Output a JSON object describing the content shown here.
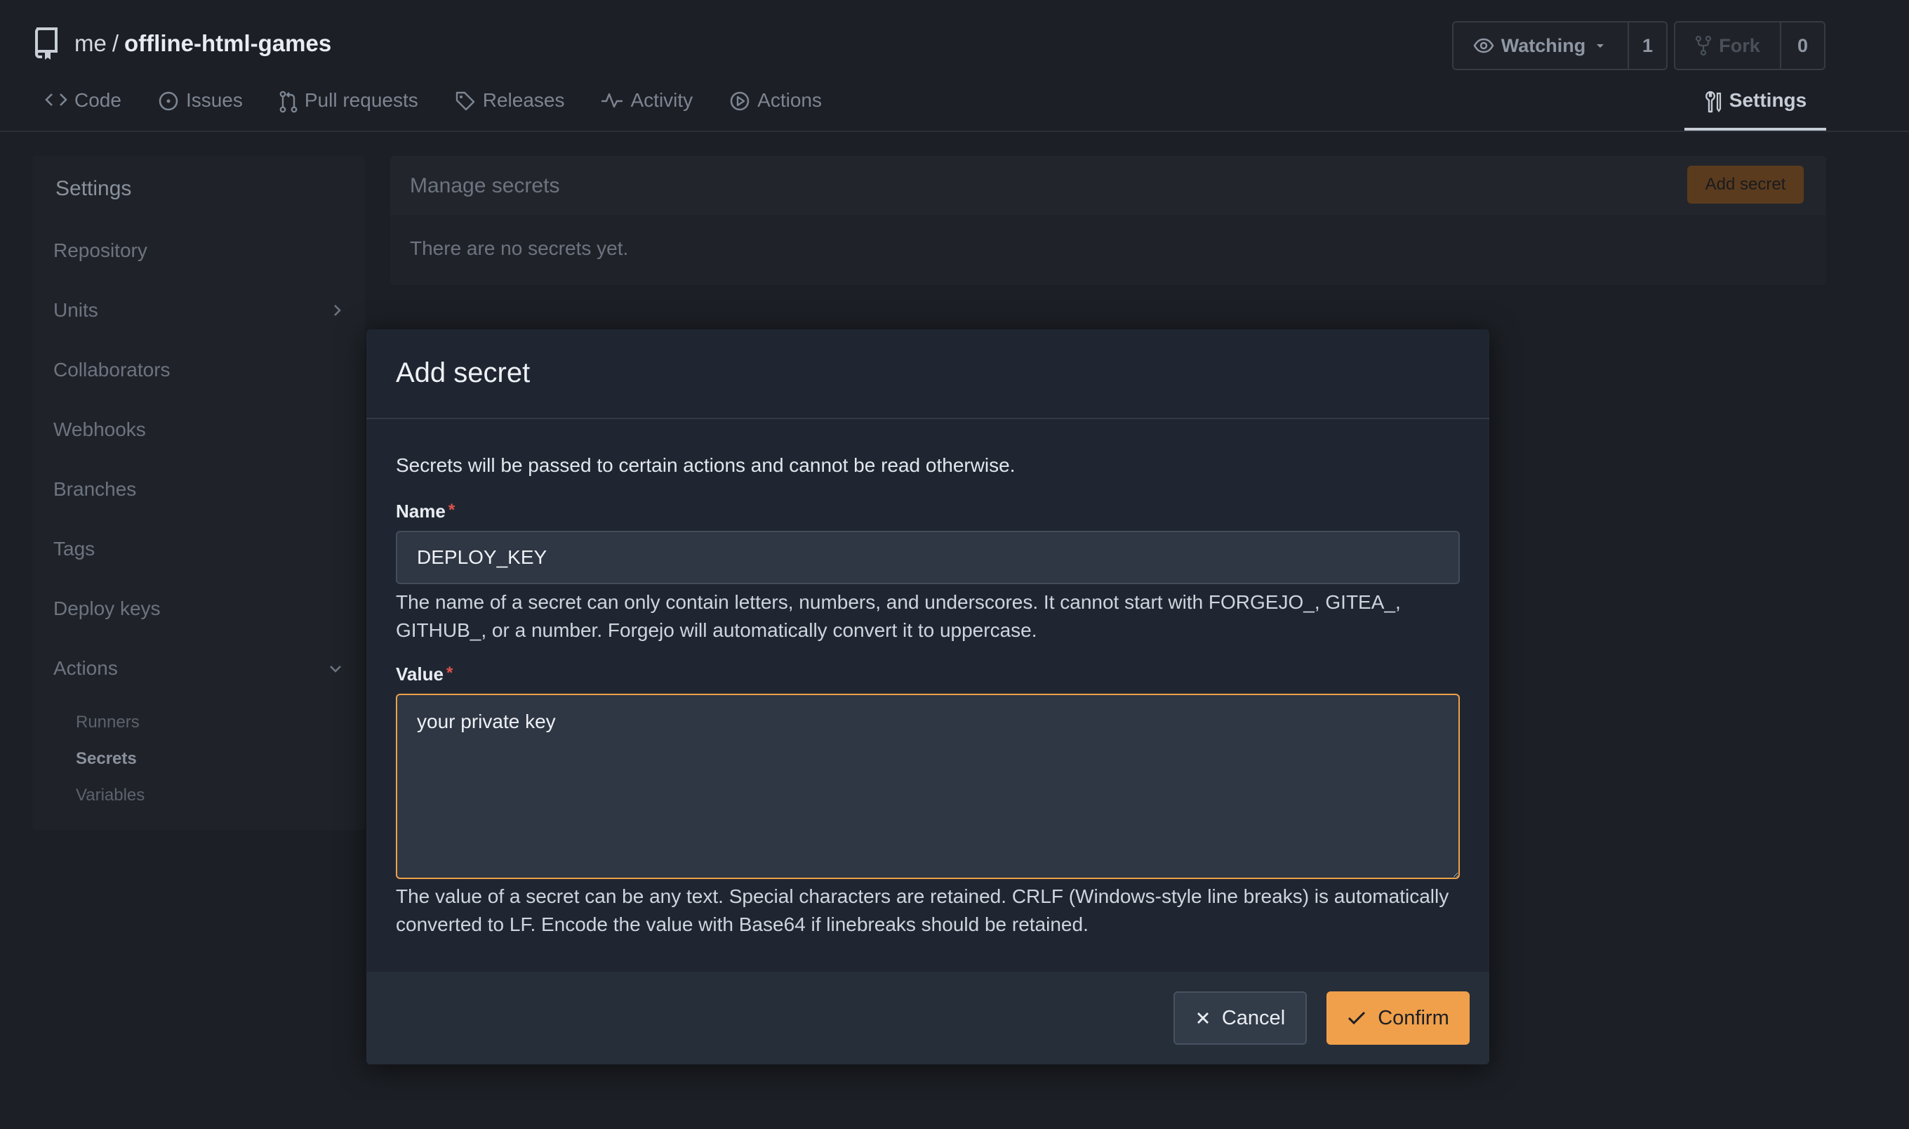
{
  "repo": {
    "owner": "me",
    "separator": "/",
    "name": "offline-html-games"
  },
  "header": {
    "watch": {
      "label": "Watching",
      "count": "1"
    },
    "fork": {
      "label": "Fork",
      "count": "0"
    }
  },
  "tabs": {
    "code": "Code",
    "issues": "Issues",
    "pulls": "Pull requests",
    "releases": "Releases",
    "activity": "Activity",
    "actions": "Actions",
    "settings": "Settings"
  },
  "sidebar": {
    "title": "Settings",
    "items": {
      "repository": "Repository",
      "units": "Units",
      "collaborators": "Collaborators",
      "webhooks": "Webhooks",
      "branches": "Branches",
      "tags": "Tags",
      "deploy_keys": "Deploy keys",
      "actions": "Actions"
    },
    "subitems": {
      "runners": "Runners",
      "secrets": "Secrets",
      "variables": "Variables"
    }
  },
  "secrets": {
    "title": "Manage secrets",
    "add_button": "Add secret",
    "empty": "There are no secrets yet."
  },
  "modal": {
    "title": "Add secret",
    "description": "Secrets will be passed to certain actions and cannot be read otherwise.",
    "name_label": "Name",
    "required_mark": "*",
    "name_value": "DEPLOY_KEY",
    "name_help": "The name of a secret can only contain letters, numbers, and underscores. It cannot start with FORGEJO_, GITEA_, GITHUB_, or a number. Forgejo will automatically convert it to uppercase.",
    "value_label": "Value",
    "value_value": "your private key",
    "value_help": "The value of a secret can be any text. Special characters are retained. CRLF (Windows-style line breaks) is automatically converted to LF. Encode the value with Base64 if linebreaks should be retained.",
    "cancel": "Cancel",
    "confirm": "Confirm"
  },
  "colors": {
    "accent": "#f0a04a",
    "required": "#e0534a",
    "background": "#1c1f25",
    "modal": "#1f2631"
  }
}
